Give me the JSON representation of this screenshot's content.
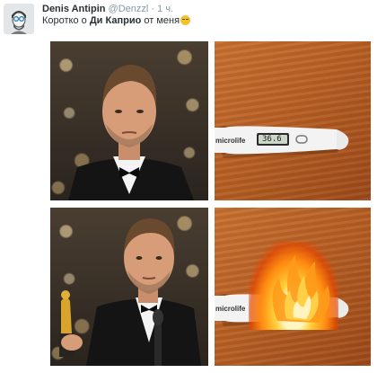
{
  "tweet": {
    "display_name": "Denis Antipin",
    "handle": "@Denzzl",
    "separator": "·",
    "time": "1 ч.",
    "text_before": "Коротко о ",
    "text_bold": "Ди Каприо",
    "text_after": " от меня",
    "emoji": "slightly-smiling-emoji"
  },
  "thermometer": {
    "brand": "microlife",
    "reading": "36.6"
  },
  "colors": {
    "name_text": "#292f33",
    "meta_text": "#8899a6",
    "suit": "#141414",
    "wood": "#b85f23",
    "flame": "#ff8a10"
  }
}
